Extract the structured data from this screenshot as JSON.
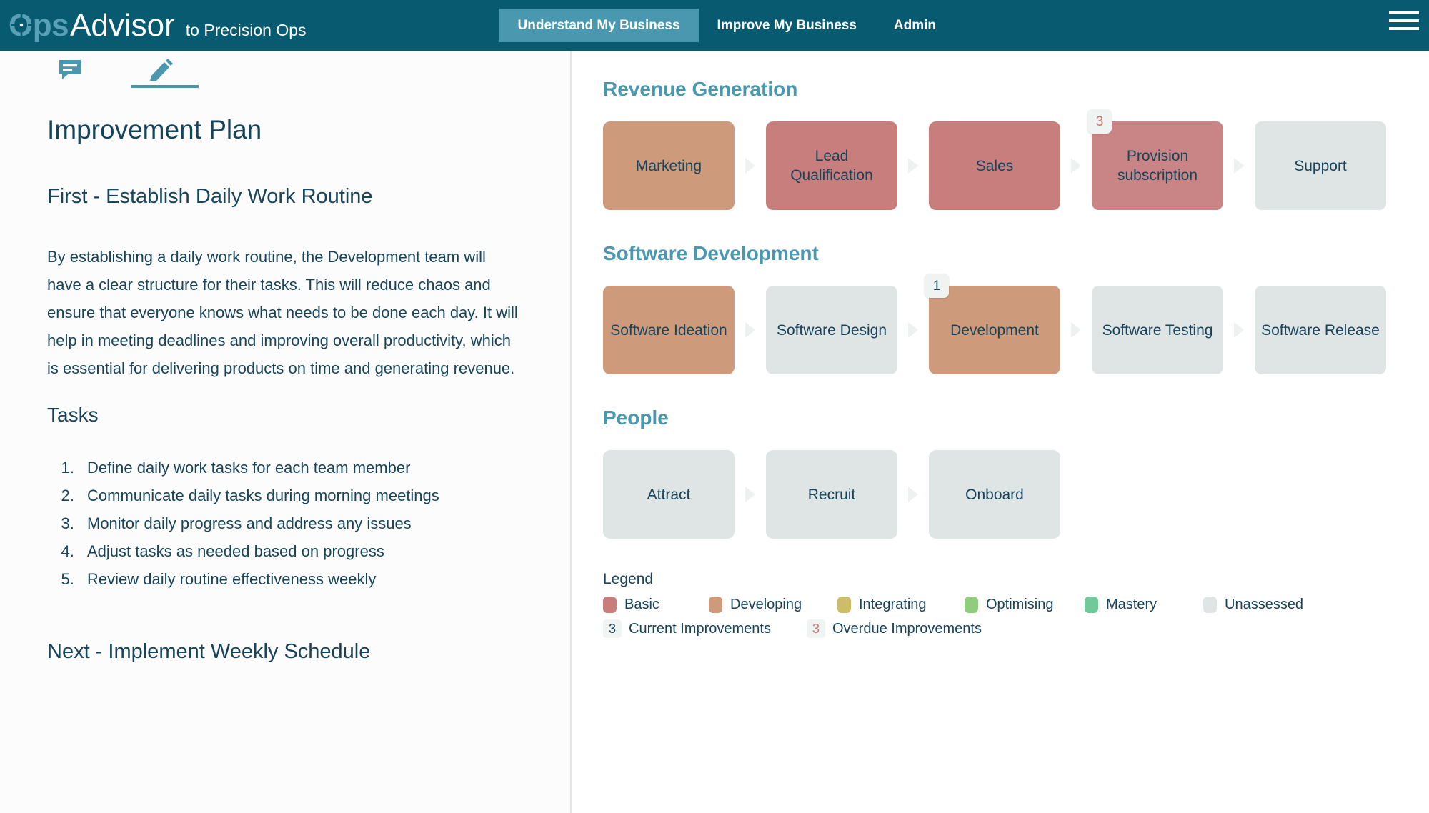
{
  "header": {
    "brand_ops": "Ops",
    "brand_advisor": "Advisor",
    "brand_tagline": "to Precision Ops",
    "nav": [
      {
        "label": "Understand My Business",
        "active": true
      },
      {
        "label": "Improve My Business",
        "active": false
      },
      {
        "label": "Admin",
        "active": false
      }
    ],
    "menu_icon": "hamburger-icon",
    "bar_color": "#075A70",
    "active_tab_color": "#4A98AF"
  },
  "left_panel": {
    "tabs": [
      {
        "icon": "comment-icon",
        "active": false
      },
      {
        "icon": "pencil-icon",
        "active": true
      }
    ],
    "title": "Improvement Plan",
    "subtitle": "First - Establish Daily Work Routine",
    "paragraph": "By establishing a daily work routine, the Development team will have a clear structure for their tasks. This will reduce chaos and ensure that everyone knows what needs to be done each day. It will help in meeting deadlines and improving overall productivity, which is essential for delivering products on time and generating revenue.",
    "tasks_heading": "Tasks",
    "tasks": [
      "Define daily work tasks for each team member",
      "Communicate daily tasks during morning meetings",
      "Monitor daily progress and address any issues",
      "Adjust tasks as needed based on progress",
      "Review daily routine effectiveness weekly"
    ],
    "next_heading": "Next - Implement Weekly Schedule"
  },
  "right_panel": {
    "sections": [
      {
        "title": "Revenue Generation",
        "nodes": [
          {
            "label": "Marketing",
            "color": "#CE9A7C",
            "badge": null,
            "badge_type": null
          },
          {
            "label": "Lead Qualification",
            "color": "#C97E7E",
            "badge": null,
            "badge_type": null
          },
          {
            "label": "Sales",
            "color": "#C97E7E",
            "badge": null,
            "badge_type": null
          },
          {
            "label": "Provision subscription",
            "color": "#C98585",
            "badge": "3",
            "badge_type": "overdue"
          },
          {
            "label": "Support",
            "color": "#DFE5E4",
            "badge": null,
            "badge_type": null
          }
        ]
      },
      {
        "title": "Software Development",
        "nodes": [
          {
            "label": "Software Ideation",
            "color": "#CE9A7C",
            "badge": null,
            "badge_type": null
          },
          {
            "label": "Software Design",
            "color": "#DFE5E4",
            "badge": null,
            "badge_type": null
          },
          {
            "label": "Development",
            "color": "#CE9A7C",
            "badge": "1",
            "badge_type": "current"
          },
          {
            "label": "Software Testing",
            "color": "#DFE5E4",
            "badge": null,
            "badge_type": null
          },
          {
            "label": "Software Release",
            "color": "#DFE5E4",
            "badge": null,
            "badge_type": null
          }
        ]
      },
      {
        "title": "People",
        "nodes": [
          {
            "label": "Attract",
            "color": "#DFE5E4",
            "badge": null,
            "badge_type": null
          },
          {
            "label": "Recruit",
            "color": "#DFE5E4",
            "badge": null,
            "badge_type": null
          },
          {
            "label": "Onboard",
            "color": "#DFE5E4",
            "badge": null,
            "badge_type": null
          }
        ]
      }
    ],
    "legend": {
      "title": "Legend",
      "maturity": [
        {
          "label": "Basic",
          "color": "#C97E7E"
        },
        {
          "label": "Developing",
          "color": "#CE9A7C"
        },
        {
          "label": "Integrating",
          "color": "#CDBC6A"
        },
        {
          "label": "Optimising",
          "color": "#8FCC7E"
        },
        {
          "label": "Mastery",
          "color": "#6FC99A"
        }
      ],
      "unassessed": {
        "label": "Unassessed",
        "color": "#DFE5E4"
      },
      "improvements": [
        {
          "count": "3",
          "label": "Current Improvements",
          "type": "current"
        },
        {
          "count": "3",
          "label": "Overdue Improvements",
          "type": "overdue"
        }
      ]
    }
  }
}
